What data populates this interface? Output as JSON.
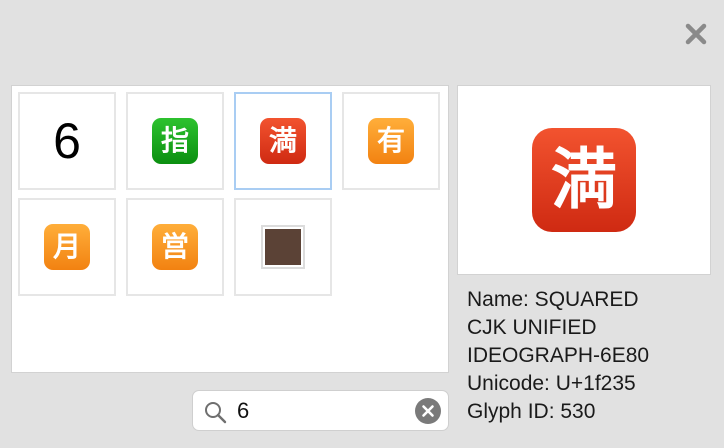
{
  "colors": {
    "red_square": "#e53a1f",
    "green_square": "#14a418",
    "orange_square": "#f8951f",
    "brown_square": "#5b4236",
    "selection_border": "#a9cdf3"
  },
  "grid": {
    "cells": [
      {
        "glyph": "6",
        "kind": "digit"
      },
      {
        "glyph": "指",
        "kind": "emoji",
        "color": "green_square"
      },
      {
        "glyph": "満",
        "kind": "emoji",
        "color": "red_square",
        "selected": true
      },
      {
        "glyph": "有",
        "kind": "emoji",
        "color": "orange_square"
      },
      {
        "glyph": "月",
        "kind": "emoji",
        "color": "orange_square"
      },
      {
        "glyph": "営",
        "kind": "emoji",
        "color": "orange_square"
      },
      {
        "glyph": "",
        "kind": "brown-square",
        "color": "brown_square"
      }
    ]
  },
  "preview": {
    "glyph": "満"
  },
  "info": {
    "name_line1": "Name: SQUARED",
    "name_line2": "CJK UNIFIED",
    "name_line3": "IDEOGRAPH-6E80",
    "unicode": "Unicode: U+1f235",
    "glyph_id": "Glyph ID: 530"
  },
  "search": {
    "value": "6"
  },
  "icons": {
    "close": "close-icon",
    "search": "search-icon",
    "clear": "clear-search-icon"
  }
}
